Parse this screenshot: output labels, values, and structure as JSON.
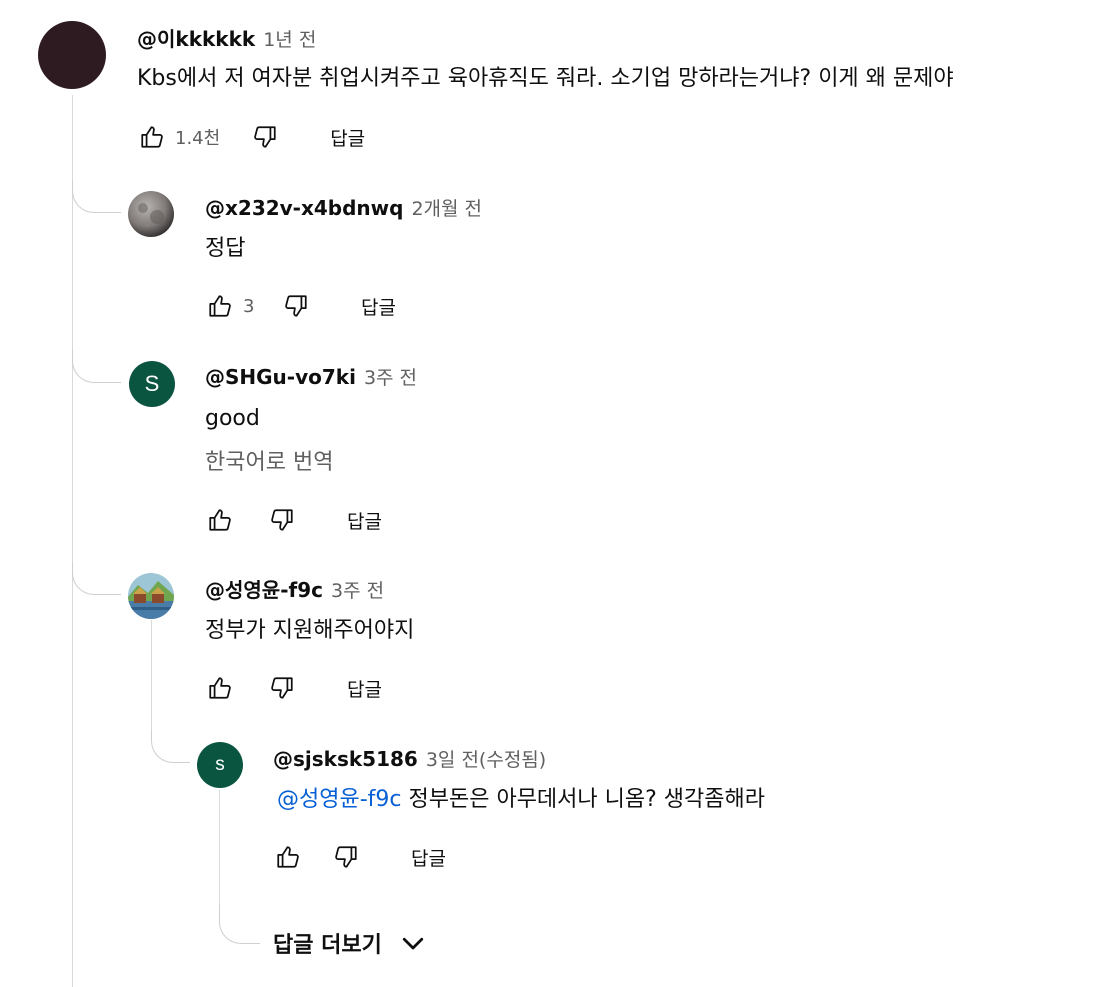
{
  "comment": {
    "author": "@이kkkkkk",
    "time": "1년 전",
    "text": "Kbs에서 저 여자분 취업시켜주고 육아휴직도 줘라. 소기업 망하라는거냐? 이게 왜 문제야",
    "likes": "1.4천",
    "reply_label": "답글",
    "avatar_color": "#2e1b22"
  },
  "replies": [
    {
      "author": "@x232v-x4bdnwq",
      "time": "2개월 전",
      "text": "정답",
      "likes": "3",
      "reply_label": "답글",
      "avatar_icon": "moon-avatar"
    },
    {
      "author": "@SHGu-vo7ki",
      "time": "3주 전",
      "text": "good",
      "translate": "한국어로 번역",
      "likes": "",
      "reply_label": "답글",
      "avatar_letter": "S",
      "avatar_color": "#0a5540"
    },
    {
      "author": "@성영윤-f9c",
      "time": "3주 전",
      "text": "정부가 지원해주어야지",
      "likes": "",
      "reply_label": "답글",
      "avatar_icon": "landscape-avatar"
    }
  ],
  "nested_reply": {
    "author": "@sjsksk5186",
    "time": "3일 전(수정됨)",
    "mention": "@성영윤-f9c",
    "text": "정부돈은 아무데서나 니옴? 생각좀해라",
    "likes": "",
    "reply_label": "답글",
    "avatar_letter": "s",
    "avatar_color": "#0a5540"
  },
  "more_replies": {
    "label": "답글 더보기",
    "icon": "chevron-down-icon"
  }
}
